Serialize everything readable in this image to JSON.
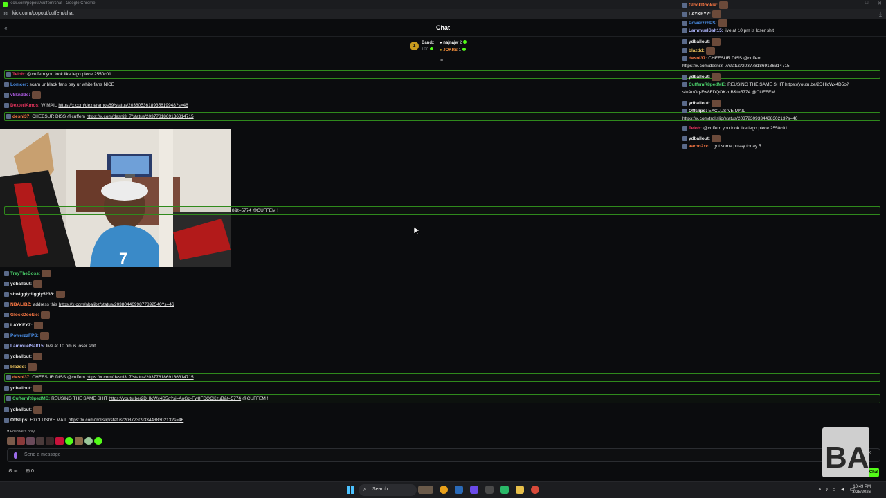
{
  "browser": {
    "window_title": "kick.com/popout/cuffem/chat - Google Chrome",
    "url": "kick.com/popout/cuffem/chat"
  },
  "chat": {
    "title": "Chat",
    "leaderboard": {
      "rank": "1",
      "top_name": "Bandz",
      "top_value": "100",
      "entries": [
        {
          "name": "najnajw",
          "value": "2"
        },
        {
          "name": "JOKRS",
          "value": "1"
        }
      ]
    }
  },
  "messages_left": [
    {
      "user": "Teioh",
      "color": "#e7345e",
      "text": "@cuffem you look like lego piece 2550c01",
      "hl": true
    },
    {
      "user": "Lomcer",
      "color": "#4b8fe8",
      "text": "scam ur black fans pay ur white fans NICE"
    },
    {
      "user": "v8kndde",
      "color": "#b35ee8",
      "text": ""
    },
    {
      "user": "DexteriAmos",
      "color": "#e7345e",
      "text": "W MAIL",
      "link": "https://x.com/dexteramos69/status/2038053618935619948?s=46"
    },
    {
      "user": "desni37",
      "color": "#ff7a45",
      "text": "CHEESUR DISS @cuffem",
      "link": "https://x.com/desni3_7/status/2037781869136314715",
      "hl": true
    }
  ],
  "messages_left_cam_fragment": "8&t=5774 @CUFFEM !",
  "messages_left_lower": [
    {
      "user": "TreyTheBoss",
      "color": "#4bd06b",
      "text": ""
    },
    {
      "user": "ydballout",
      "color": "#e8e8e8",
      "text": ""
    },
    {
      "user": "shwigglydiggly5236",
      "color": "#e8e8e8",
      "text": ""
    },
    {
      "user": "NBALIBZ",
      "color": "#ff7a45",
      "text": "address this",
      "link": "https://x.com/nbalibz/status/2038044699877892540?s=46"
    },
    {
      "user": "GlockDookie",
      "color": "#ff7a45",
      "text": ""
    },
    {
      "user": "LAYKEYZ",
      "color": "#e8e8e8",
      "text": ""
    },
    {
      "user": "PowerzzFPS",
      "color": "#4b8fe8",
      "text": ""
    },
    {
      "user": "LammuelSalt15",
      "color": "#b0b8ff",
      "text": "live at 10 pm is loser shit"
    },
    {
      "user": "ydballout",
      "color": "#e8e8e8",
      "text": ""
    },
    {
      "user": "blazdd",
      "color": "#e8c05e",
      "text": ""
    },
    {
      "user": "desni37",
      "color": "#ff7a45",
      "text": "CHEESUR DISS @cuffem",
      "link": "https://x.com/desni3_7/status/2037781869136314715",
      "hl": true
    },
    {
      "user": "ydballout",
      "color": "#e8e8e8",
      "text": ""
    },
    {
      "user": "CuffemR8pedME",
      "color": "#4bd06b",
      "text": "REUSING THE SAME SHIT",
      "link": "https://youtu.be/2DHlcWx4D5o?si=AoGq-Fw8FDQOKzuB&t=5774",
      "tail": "@CUFFEM !",
      "hl": true
    },
    {
      "user": "ydballout",
      "color": "#e8e8e8",
      "text": ""
    },
    {
      "user": "Offslips",
      "color": "#e8e8e8",
      "text": "EXCLUSIVE MAIL",
      "link": "https://x.com/trollslip/status/2037230933443830213?s=46"
    }
  ],
  "messages_right": [
    {
      "user": "GlockDookie",
      "color": "#ff7a45",
      "text": ""
    },
    {
      "user": "LAYKEYZ",
      "color": "#e8e8e8",
      "text": ""
    },
    {
      "user": "PowerzzFPS",
      "color": "#4b8fe8",
      "text": ""
    },
    {
      "user": "LammuelSalt15",
      "color": "#b0b8ff",
      "text": "live at 10 pm is loser shit"
    },
    {
      "user": "ydballout",
      "color": "#e8e8e8",
      "text": ""
    },
    {
      "user": "blazdd",
      "color": "#e8c05e",
      "text": ""
    },
    {
      "user": "desni37",
      "color": "#ff7a45",
      "text": "CHEESUR DISS @cuffem",
      "line2": "https://x.com/desni3_7/status/2037781869136314715"
    },
    {
      "user": "ydballout",
      "color": "#e8e8e8",
      "text": ""
    },
    {
      "user": "CuffemR8pedME",
      "color": "#4bd06b",
      "text": "REUSING THE SAME SHIT https://youtu.be/2DHlcWx4D5o?",
      "line2": "si=AoGq-Fw8FDQOKzuB&t=5774 @CUFFEM !"
    },
    {
      "user": "ydballout",
      "color": "#e8e8e8",
      "text": ""
    },
    {
      "user": "Offslips",
      "color": "#e8e8e8",
      "text": "EXCLUSIVE MAIL",
      "line2": "https://x.com/trollslip/status/2037230933443830213?s=46"
    },
    {
      "user": "Teioh",
      "color": "#e7345e",
      "text": "@cuffem you look like lego piece 2550c01"
    },
    {
      "user": "ydballout",
      "color": "#e8e8e8",
      "text": ""
    },
    {
      "user": "aaron2xc",
      "color": "#ff7a45",
      "text": "i got some pussy today 5"
    }
  ],
  "composer": {
    "followers_only": "Followers only",
    "placeholder": "Send a message",
    "infinity": "∞",
    "gift_count": "0",
    "send_label": "Chat"
  },
  "taskbar": {
    "search_label": "Search",
    "time": "10:49 PM",
    "date": "3/28/2026"
  },
  "colors": {
    "accent": "#53fc18",
    "highlight_border": "#2f8a1c"
  }
}
